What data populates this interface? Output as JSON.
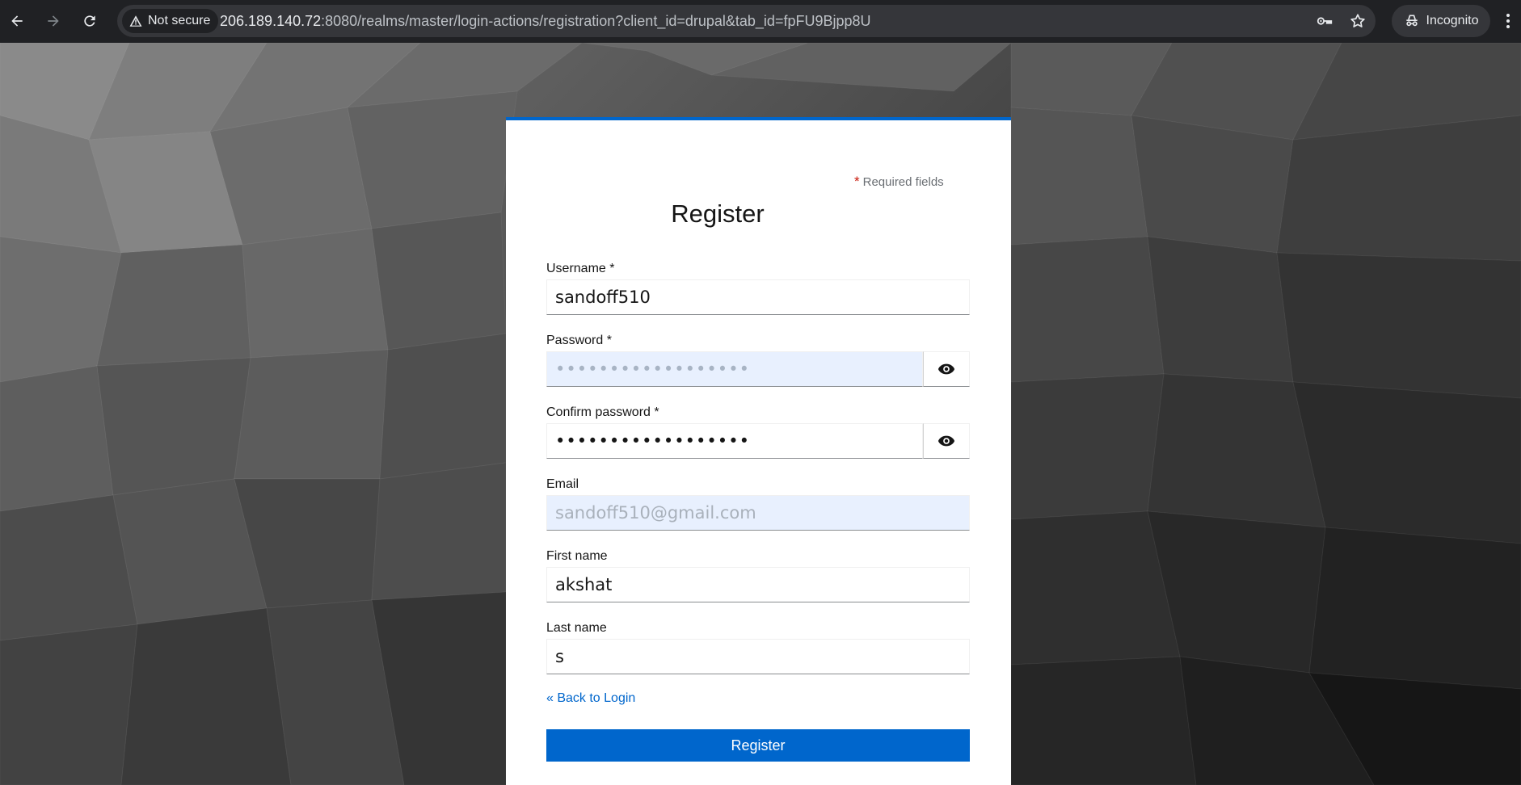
{
  "browser": {
    "security_label": "Not secure",
    "url_host": "206.189.140.72",
    "url_rest": ":8080/realms/master/login-actions/registration?client_id=drupal&tab_id=fpFU9Bjpp8U",
    "incognito_label": "Incognito"
  },
  "form": {
    "required_note": "Required fields",
    "required_star": "*",
    "title": "Register",
    "username_label": "Username *",
    "username_value": "sandoff510",
    "password_label": "Password *",
    "password_value": "••••••••••••••••••",
    "confirm_label": "Confirm password *",
    "confirm_value": "••••••••••••••••••",
    "email_label": "Email",
    "email_value": "sandoff510@gmail.com",
    "firstname_label": "First name",
    "firstname_value": "akshat",
    "lastname_label": "Last name",
    "lastname_value": "s",
    "back_link": "« Back to Login",
    "submit_label": "Register"
  },
  "icons": {
    "back": "arrow-left-icon",
    "forward": "arrow-right-icon",
    "reload": "reload-icon",
    "warning": "warning-triangle-icon",
    "key": "key-icon",
    "star": "star-icon",
    "incognito": "incognito-icon",
    "menu": "kebab-menu-icon",
    "eye": "eye-icon"
  },
  "colors": {
    "accent": "#0066cc",
    "chrome_bg": "#202124",
    "omnibox_bg": "#35363a",
    "autofill_bg": "#e8f0fe",
    "required_star": "#c9190b"
  }
}
